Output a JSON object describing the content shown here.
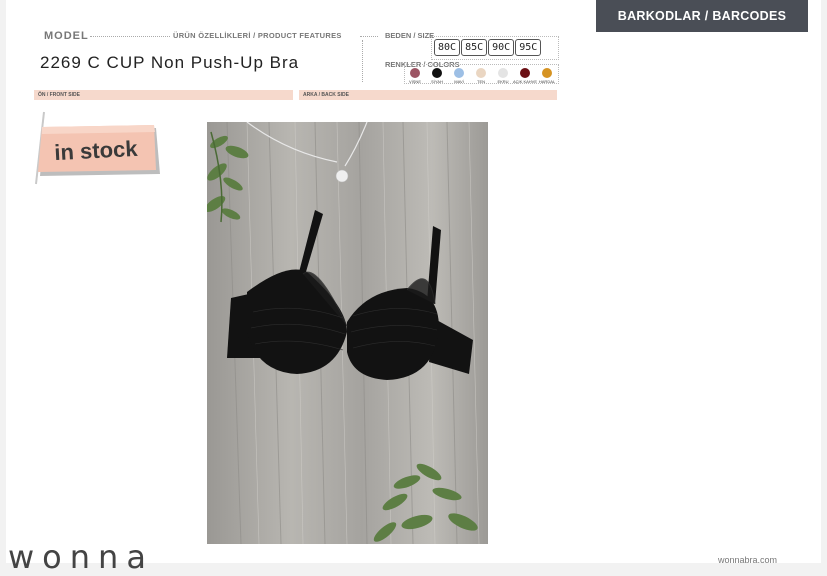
{
  "header": {
    "model_label": "MODEL",
    "features_label": "ÜRÜN ÖZELLİKLERİ / PRODUCT FEATURES",
    "product_name": "2269 C CUP Non Push-Up Bra"
  },
  "size": {
    "label": "BEDEN / SIZE",
    "options": [
      "80C",
      "85C",
      "90C",
      "95C"
    ]
  },
  "colors": {
    "label": "RENKLER / COLORS",
    "items": [
      {
        "name": "VİŞNE",
        "hex": "#9c5463"
      },
      {
        "name": "SİYAH",
        "hex": "#111111"
      },
      {
        "name": "MAVİ",
        "hex": "#9dbfe5"
      },
      {
        "name": "TEN",
        "hex": "#ead6c2"
      },
      {
        "name": "EKRU",
        "hex": "#e4e4e4"
      },
      {
        "name": "AÇIK KAHVE",
        "hex": "#6b0f14"
      },
      {
        "name": "HARDAL",
        "hex": "#d69322"
      }
    ]
  },
  "bands": {
    "front": "ÖN / FRONT SIDE",
    "back": "ARKA / BACK SIDE"
  },
  "barcodes": {
    "title": "BARKODLAR / BARCODES"
  },
  "badge": {
    "text": "in stock"
  },
  "brand": {
    "logo": "wonna",
    "site": "wonnabra.com"
  }
}
